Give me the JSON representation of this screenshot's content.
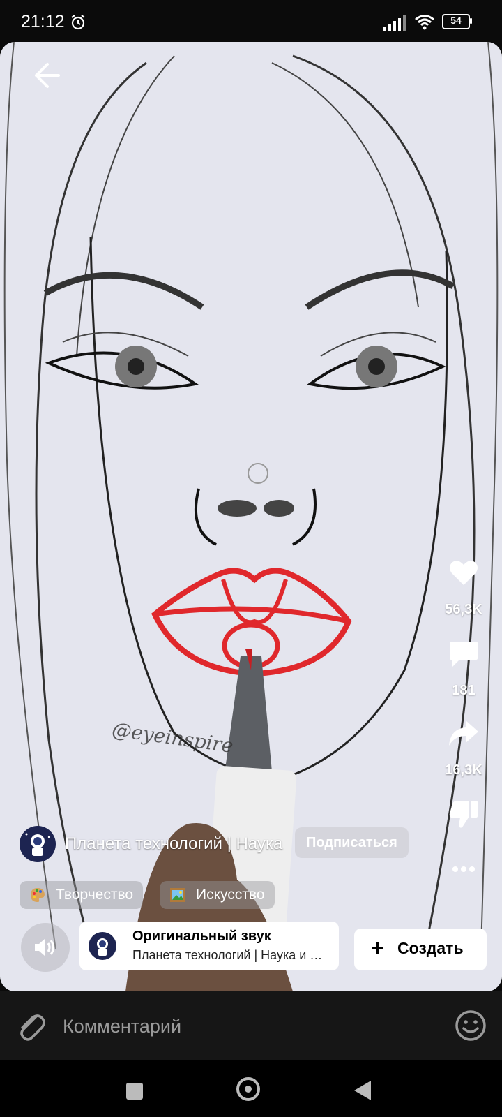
{
  "status_bar": {
    "time": "21:12",
    "battery": "54"
  },
  "post": {
    "author": "Планета технологий | Наука",
    "subscribe_label": "Подписаться",
    "tags": [
      {
        "icon": "palette-icon",
        "label": "Творчество"
      },
      {
        "icon": "framed-picture-icon",
        "label": "Искусство"
      }
    ],
    "watermark": "@eyeinspire"
  },
  "actions": {
    "likes": "56,3K",
    "comments": "181",
    "shares": "16,3K"
  },
  "audio": {
    "title": "Оригинальный звук",
    "subtitle": "Планета технологий | Наука и техника"
  },
  "create_label": "Создать",
  "comment": {
    "placeholder": "Комментарий"
  }
}
